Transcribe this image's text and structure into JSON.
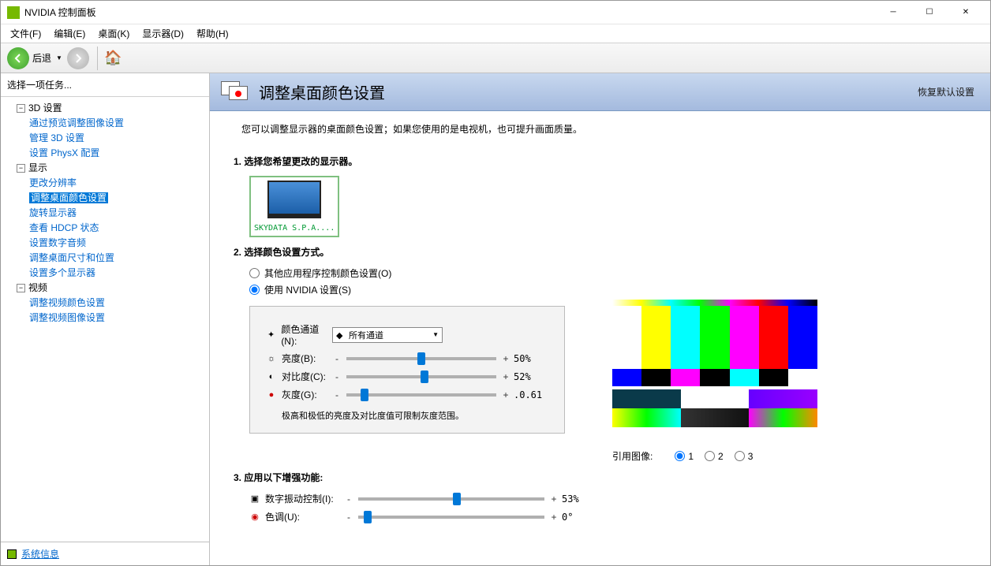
{
  "window": {
    "title": "NVIDIA 控制面板"
  },
  "menubar": [
    "文件(F)",
    "编辑(E)",
    "桌面(K)",
    "显示器(D)",
    "帮助(H)"
  ],
  "toolbar": {
    "back": "后退"
  },
  "sidebar": {
    "header": "选择一项任务...",
    "groups": [
      {
        "label": "3D 设置",
        "items": [
          "通过预览调整图像设置",
          "管理 3D 设置",
          "设置 PhysX 配置"
        ]
      },
      {
        "label": "显示",
        "items": [
          "更改分辨率",
          "调整桌面颜色设置",
          "旋转显示器",
          "查看 HDCP 状态",
          "设置数字音频",
          "调整桌面尺寸和位置",
          "设置多个显示器"
        ],
        "selected": 1
      },
      {
        "label": "视频",
        "items": [
          "调整视频颜色设置",
          "调整视频图像设置"
        ]
      }
    ]
  },
  "sysinfo": "系统信息",
  "banner": {
    "title": "调整桌面颜色设置",
    "restore": "恢复默认设置"
  },
  "description": "您可以调整显示器的桌面颜色设置；如果您使用的是电视机，也可提升画面质量。",
  "section1": {
    "title": "1.  选择您希望更改的显示器。",
    "monitor": "SKYDATA S.P.A...."
  },
  "section2": {
    "title": "2.  选择颜色设置方式。",
    "opt1": "其他应用程序控制颜色设置(O)",
    "opt2": "使用 NVIDIA 设置(S)",
    "channel_label": "颜色通道(N):",
    "channel_value": "所有通道",
    "sliders": [
      {
        "icon": "☼",
        "label": "亮度(B):",
        "value": "50%",
        "pos": 50
      },
      {
        "icon": "◐",
        "label": "对比度(C):",
        "value": "52%",
        "pos": 52
      },
      {
        "icon": "●",
        "label": "灰度(G):",
        "value": ".0.61",
        "pos": 12
      }
    ],
    "note": "极高和极低的亮度及对比度值可限制灰度范围。"
  },
  "section3": {
    "title": "3.  应用以下增强功能:",
    "sliders": [
      {
        "icon": "▣",
        "label": "数字振动控制(I):",
        "value": "53%",
        "pos": 53
      },
      {
        "icon": "◉",
        "label": "色调(U):",
        "value": "0°",
        "pos": 5
      }
    ]
  },
  "img_ref": {
    "label": "引用图像:",
    "options": [
      "1",
      "2",
      "3"
    ]
  }
}
